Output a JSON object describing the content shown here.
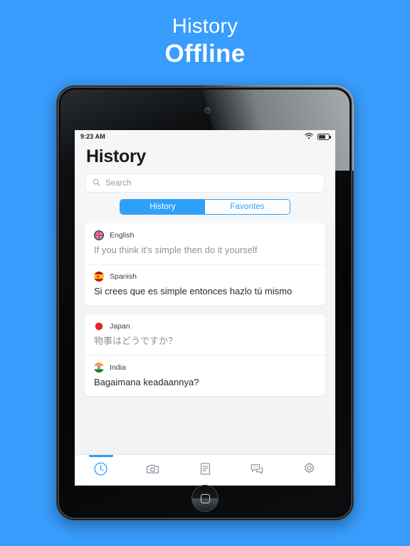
{
  "promo": {
    "line1": "History",
    "line2": "Offline"
  },
  "colors": {
    "background": "#389dfc",
    "accent": "#2fa0f8",
    "screen_bg": "#f2f3f5",
    "card_bg": "#ffffff",
    "source_text": "#8e9297",
    "target_text": "#26292d"
  },
  "device": {
    "camera_icon": "camera-dot",
    "home_button_icon": "rounded-square-icon"
  },
  "statusbar": {
    "time": "9:23 AM",
    "wifi_icon": "wifi-icon",
    "battery_icon": "battery-icon",
    "battery_level": 68
  },
  "header": {
    "title": "History"
  },
  "search": {
    "icon": "search-icon",
    "placeholder": "Search",
    "value": ""
  },
  "segmented": {
    "selected": "History",
    "options": [
      {
        "label": "History",
        "active": true
      },
      {
        "label": "Favorites",
        "active": false
      }
    ]
  },
  "cards": [
    {
      "entries": [
        {
          "flag": "flag-uk",
          "language": "English",
          "text": "If you think it's simple then do it yourself",
          "role": "source"
        },
        {
          "flag": "flag-spain",
          "language": "Spanish",
          "text": "Si crees que es simple entonces hazlo tú mismo",
          "role": "target"
        }
      ]
    },
    {
      "entries": [
        {
          "flag": "flag-japan",
          "language": "Japan",
          "text": "物事はどうですか？",
          "role": "source"
        },
        {
          "flag": "flag-india",
          "language": "India",
          "text": "Bagaimana keadaannya?",
          "role": "target"
        }
      ]
    }
  ],
  "tabbar": {
    "items": [
      {
        "icon": "clock-icon",
        "name": "history",
        "active": true
      },
      {
        "icon": "camera-icon",
        "name": "camera",
        "active": false
      },
      {
        "icon": "document-icon",
        "name": "document",
        "active": false
      },
      {
        "icon": "chat-icon",
        "name": "conversation",
        "active": false
      },
      {
        "icon": "gear-icon",
        "name": "settings",
        "active": false
      }
    ]
  }
}
